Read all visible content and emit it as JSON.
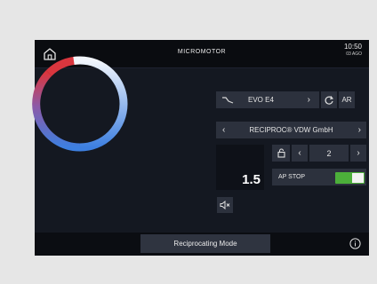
{
  "header": {
    "title": "MICROMOTOR",
    "time": "10:50",
    "date": "03 AGO"
  },
  "instrument": {
    "name": "EVO E4",
    "ar_label": "AR"
  },
  "file_system": {
    "name": "RECIPROC® VDW GmbH"
  },
  "step": {
    "value": "2"
  },
  "speed": {
    "value": "1.5"
  },
  "ap_stop": {
    "label": "AP STOP",
    "on": true
  },
  "footer": {
    "mode_label": "Reciprocating Mode"
  },
  "icons": {
    "home": "home-icon",
    "instrument": "file-instrument-icon",
    "rotation": "rotation-icon",
    "lock": "lock-icon",
    "sound": "sound-off-icon",
    "info": "info-icon"
  },
  "colors": {
    "accent_blue": "#3d7fe0",
    "accent_red": "#d9363e",
    "toggle_green": "#4caf3a",
    "gauge_top": "#f2f6fc"
  }
}
